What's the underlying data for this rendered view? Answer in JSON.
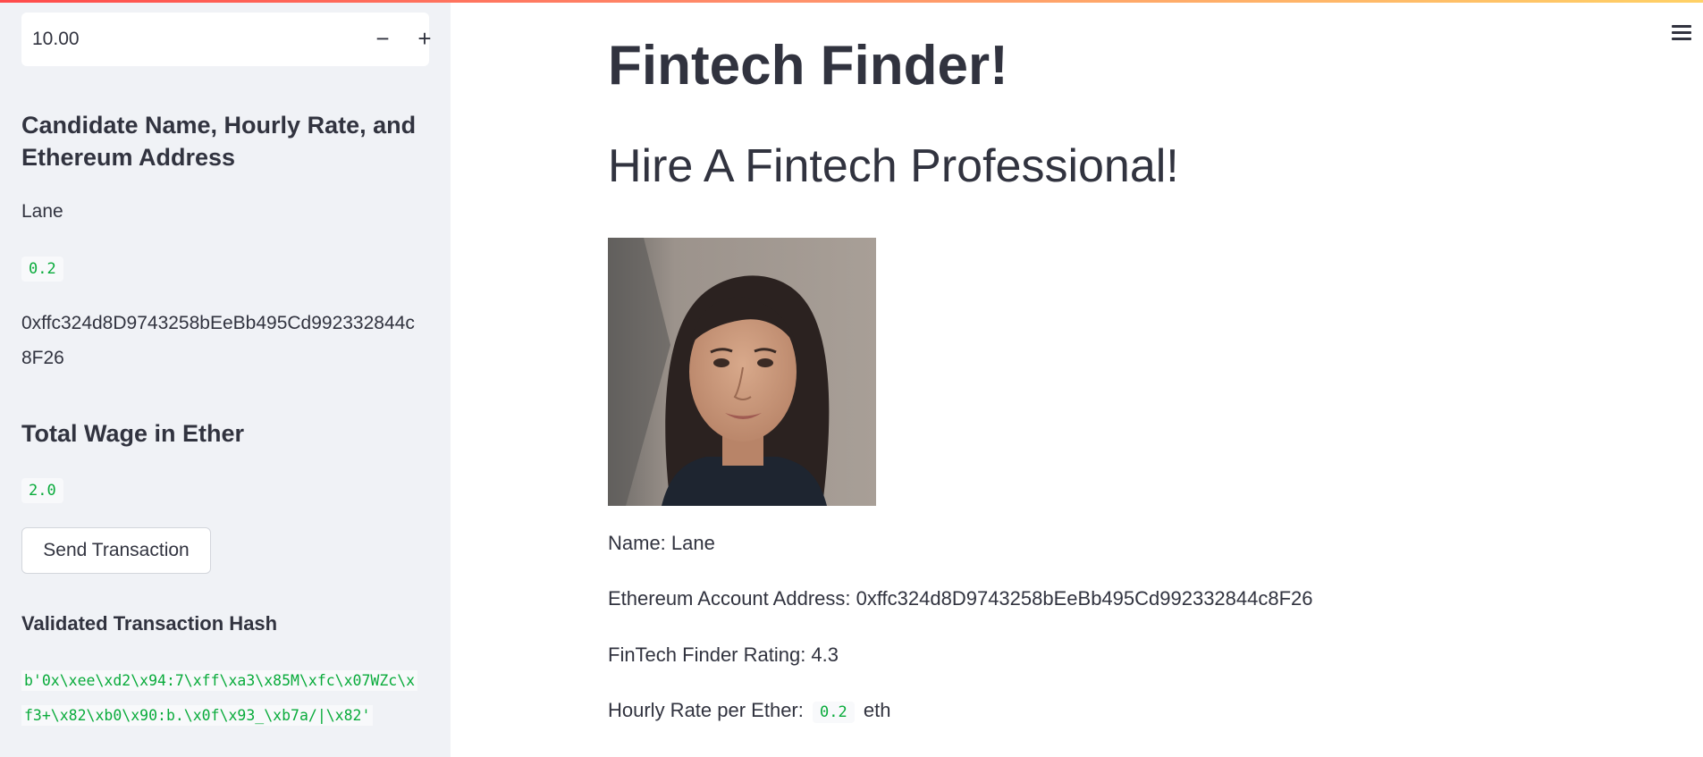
{
  "sidebar": {
    "number_input": {
      "value": "10.00",
      "minus_label": "−",
      "plus_label": "+"
    },
    "candidate_heading": "Candidate Name, Hourly Rate, and Ethereum Address",
    "candidate_name": "Lane",
    "hourly_rate": "0.2",
    "eth_address_line1": "0xffc324d8D9743258bEeBb495Cd992332844c",
    "eth_address_line2": "8F26",
    "total_wage_heading": "Total Wage in Ether",
    "total_wage": "2.0",
    "send_button_label": "Send Transaction",
    "hash_heading": "Validated Transaction Hash",
    "hash_value": "b'0x\\xee\\xd2\\x94:7\\xff\\xa3\\x85M\\xfc\\x07WZc\\xf3+\\x82\\xb0\\x90:b.\\x0f\\x93_\\xb7a/|\\x82'"
  },
  "main": {
    "title": "Fintech Finder!",
    "subtitle": "Hire A Fintech Professional!",
    "candidate": {
      "name_text": "Name: Lane",
      "address_text": "Ethereum Account Address: 0xffc324d8D9743258bEeBb495Cd992332844c8F26",
      "rating_text": "FinTech Finder Rating: 4.3",
      "rate_prefix": "Hourly Rate per Ether:",
      "rate_value": "0.2",
      "rate_suffix": "eth"
    }
  },
  "icons": {
    "menu": "hamburger-menu-icon"
  },
  "colors": {
    "sidebar_bg": "#f0f2f6",
    "text": "#31333f",
    "code_green": "#09ab3b",
    "top_bar_start": "#ff4b4b",
    "top_bar_end": "#ffd166"
  }
}
